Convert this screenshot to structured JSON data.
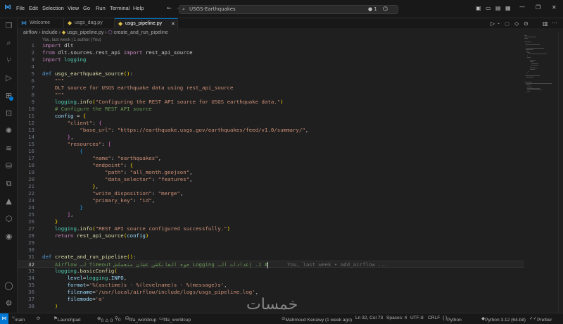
{
  "titlebar": {
    "menu": [
      "File",
      "Edit",
      "Selection",
      "View",
      "Go",
      "Run",
      "Terminal",
      "Help"
    ],
    "search_text": "USGS-Earthquakes",
    "badge": "1"
  },
  "tabs": [
    {
      "label": "Welcome",
      "icon": "vscode-icon",
      "active": false
    },
    {
      "label": "usgs_dag.py",
      "icon": "python-icon",
      "active": false
    },
    {
      "label": "usgs_pipeline.py",
      "icon": "python-icon",
      "active": true
    }
  ],
  "breadcrumb": [
    "airflow",
    "include",
    "usgs_pipeline.py",
    "create_and_run_pipeline"
  ],
  "codelens_top": "You, last week | 1 author (You)",
  "editor": {
    "current_line": 32,
    "ghost_blame": "You, last week • add_airflow ...",
    "lines": [
      {
        "n": "1",
        "code": [
          [
            "kw",
            "import"
          ],
          [
            "plain",
            " dlt"
          ]
        ]
      },
      {
        "n": "2",
        "code": [
          [
            "kw",
            "from"
          ],
          [
            "plain",
            " dlt.sources.rest_api "
          ],
          [
            "kw",
            "import"
          ],
          [
            "plain",
            " rest_api_source"
          ]
        ]
      },
      {
        "n": "3",
        "code": [
          [
            "kw",
            "import"
          ],
          [
            "plain",
            " "
          ],
          [
            "mod",
            "logging"
          ]
        ]
      },
      {
        "n": "4",
        "code": []
      },
      {
        "n": "5",
        "code": [
          [
            "kw2",
            "def"
          ],
          [
            "plain",
            " "
          ],
          [
            "fn",
            "usgs_earthquake_source"
          ],
          [
            "br1",
            "("
          ],
          [
            "br1",
            ")"
          ],
          [
            "plain",
            ":"
          ]
        ]
      },
      {
        "n": "6",
        "code": [
          [
            "plain",
            "    "
          ],
          [
            "str",
            "\"\"\""
          ]
        ]
      },
      {
        "n": "7",
        "code": [
          [
            "plain",
            "    "
          ],
          [
            "str",
            "DLT source for USGS earthquake data using rest_api_source"
          ]
        ]
      },
      {
        "n": "8",
        "code": [
          [
            "plain",
            "    "
          ],
          [
            "str",
            "\"\"\""
          ]
        ]
      },
      {
        "n": "9",
        "code": [
          [
            "plain",
            "    "
          ],
          [
            "mod",
            "logging"
          ],
          [
            "plain",
            "."
          ],
          [
            "fn",
            "info"
          ],
          [
            "br1",
            "("
          ],
          [
            "str",
            "\"Configuring the REST API source for USGS earthquake data.\""
          ],
          [
            "br1",
            ")"
          ]
        ]
      },
      {
        "n": "10",
        "code": [
          [
            "plain",
            "    "
          ],
          [
            "cm",
            "# Configure the REST API source"
          ]
        ]
      },
      {
        "n": "11",
        "code": [
          [
            "plain",
            "    "
          ],
          [
            "var",
            "config"
          ],
          [
            "plain",
            " = "
          ],
          [
            "br1",
            "{"
          ]
        ]
      },
      {
        "n": "12",
        "code": [
          [
            "plain",
            "        "
          ],
          [
            "str",
            "\"client\""
          ],
          [
            "plain",
            ": "
          ],
          [
            "br2",
            "{"
          ]
        ]
      },
      {
        "n": "13",
        "code": [
          [
            "plain",
            "            "
          ],
          [
            "str",
            "\"base_url\""
          ],
          [
            "plain",
            ": "
          ],
          [
            "str",
            "\"https://earthquake.usgs.gov/earthquakes/feed/v1.0/summary/\""
          ],
          [
            "plain",
            ","
          ]
        ]
      },
      {
        "n": "14",
        "code": [
          [
            "plain",
            "        "
          ],
          [
            "br2",
            "}"
          ],
          [
            "plain",
            ","
          ]
        ]
      },
      {
        "n": "15",
        "code": [
          [
            "plain",
            "        "
          ],
          [
            "str",
            "\"resources\""
          ],
          [
            "plain",
            ": "
          ],
          [
            "br2",
            "["
          ]
        ]
      },
      {
        "n": "16",
        "code": [
          [
            "plain",
            "            "
          ],
          [
            "br3",
            "{"
          ]
        ]
      },
      {
        "n": "17",
        "code": [
          [
            "plain",
            "                "
          ],
          [
            "str",
            "\"name\""
          ],
          [
            "plain",
            ": "
          ],
          [
            "str",
            "\"earthquakes\""
          ],
          [
            "plain",
            ","
          ]
        ]
      },
      {
        "n": "18",
        "code": [
          [
            "plain",
            "                "
          ],
          [
            "str",
            "\"endpoint\""
          ],
          [
            "plain",
            ": "
          ],
          [
            "br1",
            "{"
          ]
        ]
      },
      {
        "n": "19",
        "code": [
          [
            "plain",
            "                    "
          ],
          [
            "str",
            "\"path\""
          ],
          [
            "plain",
            ": "
          ],
          [
            "str",
            "\"all_month.geojson\""
          ],
          [
            "plain",
            ","
          ]
        ]
      },
      {
        "n": "20",
        "code": [
          [
            "plain",
            "                    "
          ],
          [
            "str",
            "\"data_selector\""
          ],
          [
            "plain",
            ": "
          ],
          [
            "str",
            "\"features\""
          ],
          [
            "plain",
            ","
          ]
        ]
      },
      {
        "n": "21",
        "code": [
          [
            "plain",
            "                "
          ],
          [
            "br1",
            "}"
          ],
          [
            "plain",
            ","
          ]
        ]
      },
      {
        "n": "22",
        "code": [
          [
            "plain",
            "                "
          ],
          [
            "str",
            "\"write_disposition\""
          ],
          [
            "plain",
            ": "
          ],
          [
            "str",
            "\"merge\""
          ],
          [
            "plain",
            ","
          ]
        ]
      },
      {
        "n": "23",
        "code": [
          [
            "plain",
            "                "
          ],
          [
            "str",
            "\"primary_key\""
          ],
          [
            "plain",
            ": "
          ],
          [
            "str",
            "\"id\""
          ],
          [
            "plain",
            ","
          ]
        ]
      },
      {
        "n": "24",
        "code": [
          [
            "plain",
            "            "
          ],
          [
            "br3",
            "}"
          ]
        ]
      },
      {
        "n": "25",
        "code": [
          [
            "plain",
            "        "
          ],
          [
            "br2",
            "]"
          ],
          [
            "plain",
            ","
          ]
        ]
      },
      {
        "n": "26",
        "code": [
          [
            "plain",
            "    "
          ],
          [
            "br1",
            "}"
          ]
        ]
      },
      {
        "n": "27",
        "code": [
          [
            "plain",
            "    "
          ],
          [
            "mod",
            "logging"
          ],
          [
            "plain",
            "."
          ],
          [
            "fn",
            "info"
          ],
          [
            "br1",
            "("
          ],
          [
            "str",
            "\"REST API source configured successfully.\""
          ],
          [
            "br1",
            ")"
          ]
        ]
      },
      {
        "n": "28",
        "code": [
          [
            "plain",
            "    "
          ],
          [
            "kw",
            "return"
          ],
          [
            "plain",
            " "
          ],
          [
            "fn",
            "rest_api_source"
          ],
          [
            "br1",
            "("
          ],
          [
            "var",
            "config"
          ],
          [
            "br1",
            ")"
          ]
        ]
      },
      {
        "n": "29",
        "code": []
      },
      {
        "n": "30",
        "code": []
      },
      {
        "n": "31",
        "code": [
          [
            "kw2",
            "def"
          ],
          [
            "plain",
            " "
          ],
          [
            "fn",
            "create_and_run_pipeline"
          ],
          [
            "br1",
            "("
          ],
          [
            "br1",
            ")"
          ],
          [
            "plain",
            ":"
          ]
        ]
      },
      {
        "n": "32",
        "code": [
          [
            "plain",
            "    "
          ],
          [
            "cm",
            "# 1. إعدادات الـ Logging جوه الفانكشن عشان متعملش Timeout لـ Airflow"
          ],
          [
            "caret",
            ""
          ],
          [
            "ghost",
            "      You, last week • add_airflow ..."
          ]
        ]
      },
      {
        "n": "33",
        "code": [
          [
            "plain",
            "    "
          ],
          [
            "mod",
            "logging"
          ],
          [
            "plain",
            "."
          ],
          [
            "fn",
            "basicConfig"
          ],
          [
            "br1",
            "("
          ]
        ]
      },
      {
        "n": "34",
        "code": [
          [
            "plain",
            "        "
          ],
          [
            "var",
            "level"
          ],
          [
            "plain",
            "="
          ],
          [
            "mod",
            "logging"
          ],
          [
            "plain",
            "."
          ],
          [
            "var",
            "INFO"
          ],
          [
            "plain",
            ","
          ]
        ]
      },
      {
        "n": "35",
        "code": [
          [
            "plain",
            "        "
          ],
          [
            "var",
            "format"
          ],
          [
            "plain",
            "="
          ],
          [
            "str",
            "'%(asctime)s - %(levelname)s - %(message)s'"
          ],
          [
            "plain",
            ","
          ]
        ]
      },
      {
        "n": "36",
        "code": [
          [
            "plain",
            "        "
          ],
          [
            "var",
            "filename"
          ],
          [
            "plain",
            "="
          ],
          [
            "str",
            "'/usr/local/airflow/include/logs/usgs_pipeline.log'"
          ],
          [
            "plain",
            ","
          ]
        ]
      },
      {
        "n": "37",
        "code": [
          [
            "plain",
            "        "
          ],
          [
            "var",
            "filemode"
          ],
          [
            "plain",
            "="
          ],
          [
            "str",
            "'a'"
          ]
        ]
      },
      {
        "n": "38",
        "code": [
          [
            "plain",
            "    "
          ],
          [
            "br1",
            ")"
          ]
        ]
      }
    ]
  },
  "statusbar": {
    "branch": "main",
    "launchpad": "Launchpad",
    "problems": "0 ⚠ 0",
    "ports": "0",
    "env1": "fifa_worldcup",
    "env2": "fifa_worldcup",
    "blame": "Mahmoud Kenawy (1 week ago)",
    "position": "Ln 32, Col 73",
    "spaces": "Spaces: 4",
    "encoding": "UTF-8",
    "eol": "CRLF",
    "language": "Python",
    "interpreter": "Python 3.12 (64-bit)",
    "prettier": "Prettier"
  },
  "watermark": "خمسات",
  "colors": {
    "accent": "#0078d4",
    "editor_bg": "#1f1f1f",
    "chrome_bg": "#181818"
  }
}
